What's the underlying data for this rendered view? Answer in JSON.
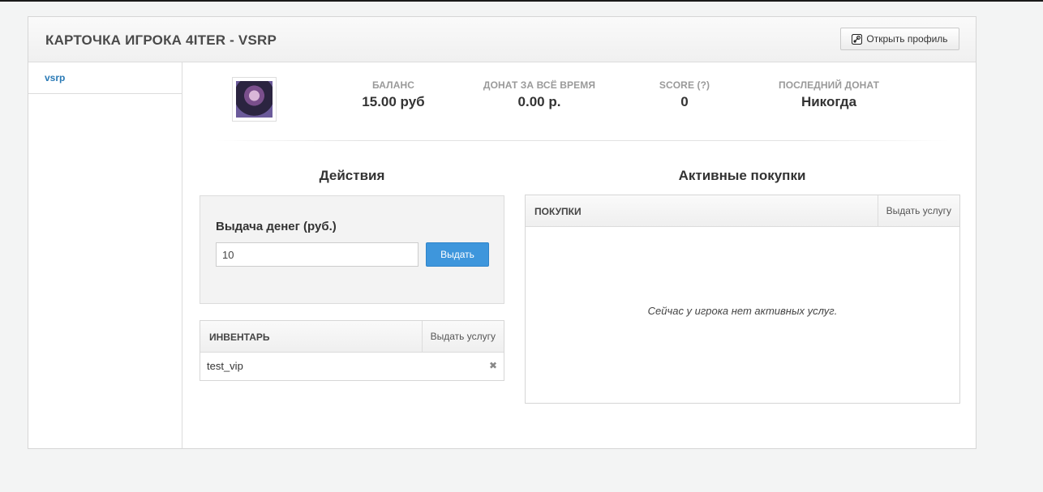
{
  "header": {
    "title": "КАРТОЧКА ИГРОКА 4ITER - VSRP",
    "open_profile_label": "Открыть профиль"
  },
  "sidebar": {
    "items": [
      {
        "label": "vsrp"
      }
    ]
  },
  "stats": {
    "balance": {
      "label": "БАЛАНС",
      "value": "15.00 руб"
    },
    "donate_total": {
      "label": "ДОНАТ ЗА ВСЁ ВРЕМЯ",
      "value": "0.00 р."
    },
    "score": {
      "label": "SCORE (?)",
      "value": "0"
    },
    "last_donate": {
      "label": "ПОСЛЕДНИЙ ДОНАТ",
      "value": "Никогда"
    }
  },
  "actions": {
    "title": "Действия",
    "money": {
      "title": "Выдача денег (руб.)",
      "input_value": "10",
      "button_label": "Выдать"
    }
  },
  "inventory": {
    "header": "ИНВЕНТАРЬ",
    "give_label": "Выдать услугу",
    "items": [
      {
        "name": "test_vip",
        "remove_icon": "✖"
      }
    ]
  },
  "purchases": {
    "title": "Активные покупки",
    "header": "ПОКУПКИ",
    "give_label": "Выдать услугу",
    "empty_text": "Сейчас у игрока нет активных услуг."
  },
  "colors": {
    "accent": "#3e96dc",
    "link": "#2a7ab6"
  }
}
